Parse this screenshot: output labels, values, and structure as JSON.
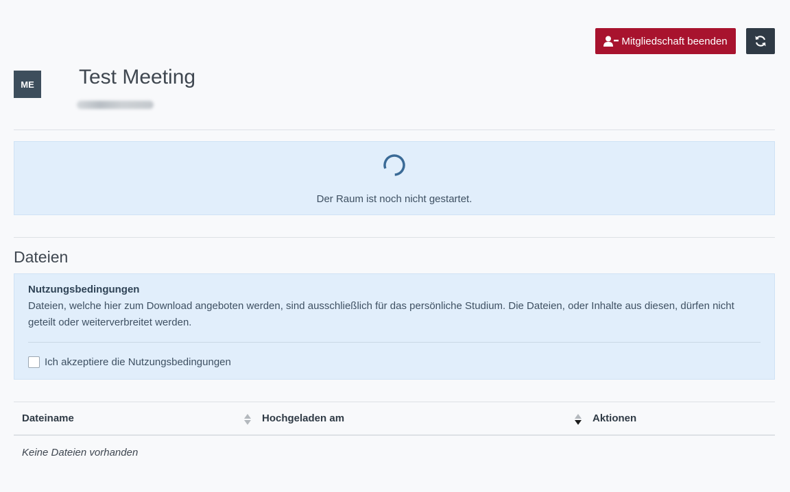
{
  "header": {
    "leave_button_label": "Mitgliedschaft beenden",
    "reload_button_icon": "sync-icon",
    "leave_button_icon": "user-minus-icon"
  },
  "room": {
    "avatar_initials": "ME",
    "title": "Test Meeting"
  },
  "status": {
    "icon": "spinner-icon",
    "message": "Der Raum ist noch nicht gestartet."
  },
  "files": {
    "section_title": "Dateien",
    "terms": {
      "heading": "Nutzungsbedingungen",
      "text": "Dateien, welche hier zum Download angeboten werden, sind ausschließlich für das persönliche Studium. Die Dateien, oder Inhalte aus diesen, dürfen nicht geteilt oder weiterverbreitet werden.",
      "accept_label": "Ich akzeptiere die Nutzungsbedingungen",
      "accepted": false
    },
    "table": {
      "columns": [
        "Dateiname",
        "Hochgeladen am",
        "Aktionen"
      ],
      "empty_text": "Keine Dateien vorhanden"
    }
  },
  "colors": {
    "danger": "#a8132e",
    "dark": "#2f3a45",
    "info_bg": "#e1eefb",
    "avatar_bg": "#3d4e5c"
  }
}
